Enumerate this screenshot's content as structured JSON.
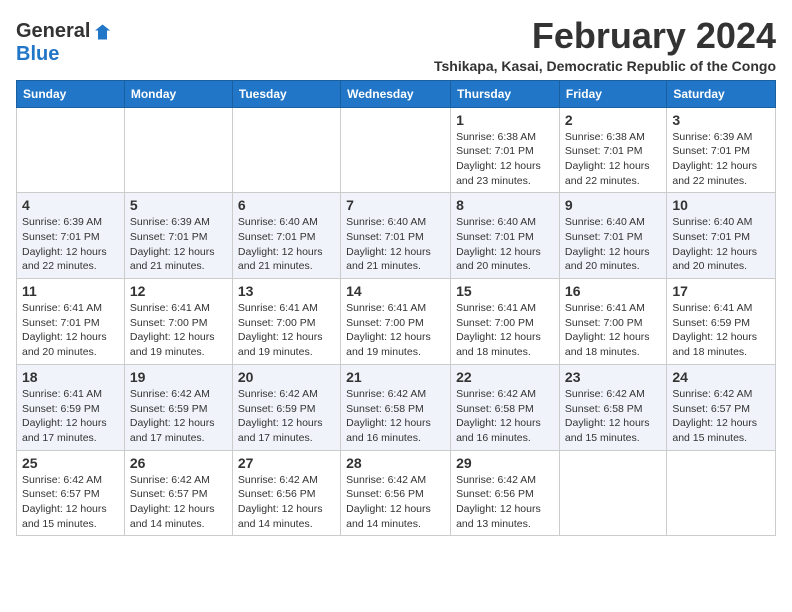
{
  "logo": {
    "general": "General",
    "blue": "Blue"
  },
  "title": {
    "month": "February 2024",
    "location": "Tshikapa, Kasai, Democratic Republic of the Congo"
  },
  "columns": [
    "Sunday",
    "Monday",
    "Tuesday",
    "Wednesday",
    "Thursday",
    "Friday",
    "Saturday"
  ],
  "weeks": [
    [
      {
        "day": "",
        "info": ""
      },
      {
        "day": "",
        "info": ""
      },
      {
        "day": "",
        "info": ""
      },
      {
        "day": "",
        "info": ""
      },
      {
        "day": "1",
        "info": "Sunrise: 6:38 AM\nSunset: 7:01 PM\nDaylight: 12 hours\nand 23 minutes."
      },
      {
        "day": "2",
        "info": "Sunrise: 6:38 AM\nSunset: 7:01 PM\nDaylight: 12 hours\nand 22 minutes."
      },
      {
        "day": "3",
        "info": "Sunrise: 6:39 AM\nSunset: 7:01 PM\nDaylight: 12 hours\nand 22 minutes."
      }
    ],
    [
      {
        "day": "4",
        "info": "Sunrise: 6:39 AM\nSunset: 7:01 PM\nDaylight: 12 hours\nand 22 minutes."
      },
      {
        "day": "5",
        "info": "Sunrise: 6:39 AM\nSunset: 7:01 PM\nDaylight: 12 hours\nand 21 minutes."
      },
      {
        "day": "6",
        "info": "Sunrise: 6:40 AM\nSunset: 7:01 PM\nDaylight: 12 hours\nand 21 minutes."
      },
      {
        "day": "7",
        "info": "Sunrise: 6:40 AM\nSunset: 7:01 PM\nDaylight: 12 hours\nand 21 minutes."
      },
      {
        "day": "8",
        "info": "Sunrise: 6:40 AM\nSunset: 7:01 PM\nDaylight: 12 hours\nand 20 minutes."
      },
      {
        "day": "9",
        "info": "Sunrise: 6:40 AM\nSunset: 7:01 PM\nDaylight: 12 hours\nand 20 minutes."
      },
      {
        "day": "10",
        "info": "Sunrise: 6:40 AM\nSunset: 7:01 PM\nDaylight: 12 hours\nand 20 minutes."
      }
    ],
    [
      {
        "day": "11",
        "info": "Sunrise: 6:41 AM\nSunset: 7:01 PM\nDaylight: 12 hours\nand 20 minutes."
      },
      {
        "day": "12",
        "info": "Sunrise: 6:41 AM\nSunset: 7:00 PM\nDaylight: 12 hours\nand 19 minutes."
      },
      {
        "day": "13",
        "info": "Sunrise: 6:41 AM\nSunset: 7:00 PM\nDaylight: 12 hours\nand 19 minutes."
      },
      {
        "day": "14",
        "info": "Sunrise: 6:41 AM\nSunset: 7:00 PM\nDaylight: 12 hours\nand 19 minutes."
      },
      {
        "day": "15",
        "info": "Sunrise: 6:41 AM\nSunset: 7:00 PM\nDaylight: 12 hours\nand 18 minutes."
      },
      {
        "day": "16",
        "info": "Sunrise: 6:41 AM\nSunset: 7:00 PM\nDaylight: 12 hours\nand 18 minutes."
      },
      {
        "day": "17",
        "info": "Sunrise: 6:41 AM\nSunset: 6:59 PM\nDaylight: 12 hours\nand 18 minutes."
      }
    ],
    [
      {
        "day": "18",
        "info": "Sunrise: 6:41 AM\nSunset: 6:59 PM\nDaylight: 12 hours\nand 17 minutes."
      },
      {
        "day": "19",
        "info": "Sunrise: 6:42 AM\nSunset: 6:59 PM\nDaylight: 12 hours\nand 17 minutes."
      },
      {
        "day": "20",
        "info": "Sunrise: 6:42 AM\nSunset: 6:59 PM\nDaylight: 12 hours\nand 17 minutes."
      },
      {
        "day": "21",
        "info": "Sunrise: 6:42 AM\nSunset: 6:58 PM\nDaylight: 12 hours\nand 16 minutes."
      },
      {
        "day": "22",
        "info": "Sunrise: 6:42 AM\nSunset: 6:58 PM\nDaylight: 12 hours\nand 16 minutes."
      },
      {
        "day": "23",
        "info": "Sunrise: 6:42 AM\nSunset: 6:58 PM\nDaylight: 12 hours\nand 15 minutes."
      },
      {
        "day": "24",
        "info": "Sunrise: 6:42 AM\nSunset: 6:57 PM\nDaylight: 12 hours\nand 15 minutes."
      }
    ],
    [
      {
        "day": "25",
        "info": "Sunrise: 6:42 AM\nSunset: 6:57 PM\nDaylight: 12 hours\nand 15 minutes."
      },
      {
        "day": "26",
        "info": "Sunrise: 6:42 AM\nSunset: 6:57 PM\nDaylight: 12 hours\nand 14 minutes."
      },
      {
        "day": "27",
        "info": "Sunrise: 6:42 AM\nSunset: 6:56 PM\nDaylight: 12 hours\nand 14 minutes."
      },
      {
        "day": "28",
        "info": "Sunrise: 6:42 AM\nSunset: 6:56 PM\nDaylight: 12 hours\nand 14 minutes."
      },
      {
        "day": "29",
        "info": "Sunrise: 6:42 AM\nSunset: 6:56 PM\nDaylight: 12 hours\nand 13 minutes."
      },
      {
        "day": "",
        "info": ""
      },
      {
        "day": "",
        "info": ""
      }
    ]
  ]
}
